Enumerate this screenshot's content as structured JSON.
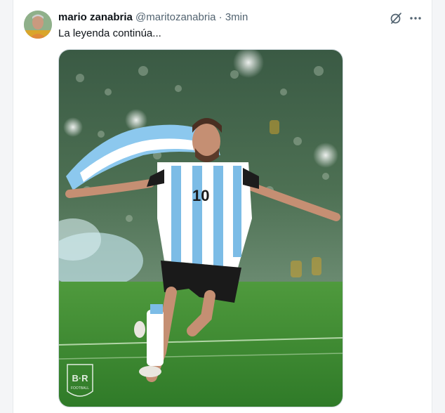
{
  "tweet": {
    "author_name": "mario zanabria",
    "author_handle": "@maritozanabria",
    "separator": "·",
    "time": "3min",
    "text": "La leyenda continúa...",
    "avatar_icon": "user-avatar"
  },
  "actions": {
    "grok_icon": "grok-icon",
    "more_icon": "more-options-icon"
  },
  "media": {
    "watermark_letters": "B·R",
    "watermark_sub": "FOOTBALL",
    "jersey_number": "10"
  },
  "colors": {
    "name": "#0f1419",
    "secondary": "#536471",
    "pitch": "#3f8a2f",
    "crowd": "#2f4f3a",
    "sky_blue": "#6fb4e3"
  }
}
